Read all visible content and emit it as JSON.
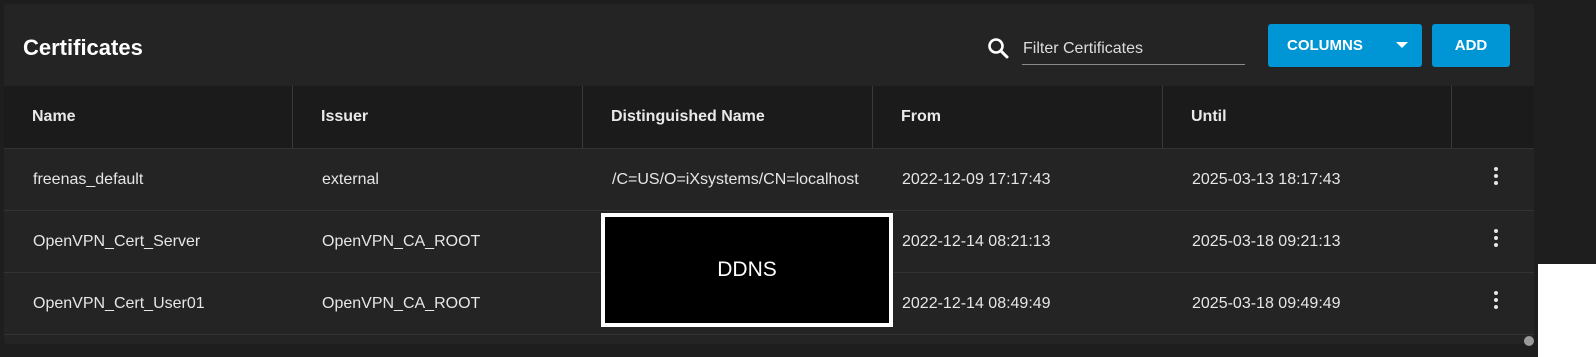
{
  "header": {
    "title": "Certificates",
    "search_placeholder": "Filter Certificates",
    "columns_button": "COLUMNS",
    "add_button": "ADD"
  },
  "table": {
    "columns": [
      "Name",
      "Issuer",
      "Distinguished Name",
      "From",
      "Until"
    ],
    "rows": [
      {
        "name": "freenas_default",
        "issuer": "external",
        "dn": "/C=US/O=iXsystems/CN=localhost",
        "from": "2022-12-09 17:17:43",
        "until": "2025-03-13 18:17:43"
      },
      {
        "name": "OpenVPN_Cert_Server",
        "issuer": "OpenVPN_CA_ROOT",
        "dn": "",
        "from": "2022-12-14 08:21:13",
        "until": "2025-03-18 09:21:13"
      },
      {
        "name": "OpenVPN_Cert_User01",
        "issuer": "OpenVPN_CA_ROOT",
        "dn": "",
        "from": "2022-12-14 08:49:49",
        "until": "2025-03-18 09:49:49"
      }
    ]
  },
  "redaction_label": "DDNS",
  "icons": {
    "search": "search-icon",
    "caret": "caret-down-icon",
    "row_menu": "more-vertical-icon"
  },
  "colors": {
    "accent": "#0095d5",
    "background": "#242424",
    "header_bg": "#1b1b1b"
  }
}
